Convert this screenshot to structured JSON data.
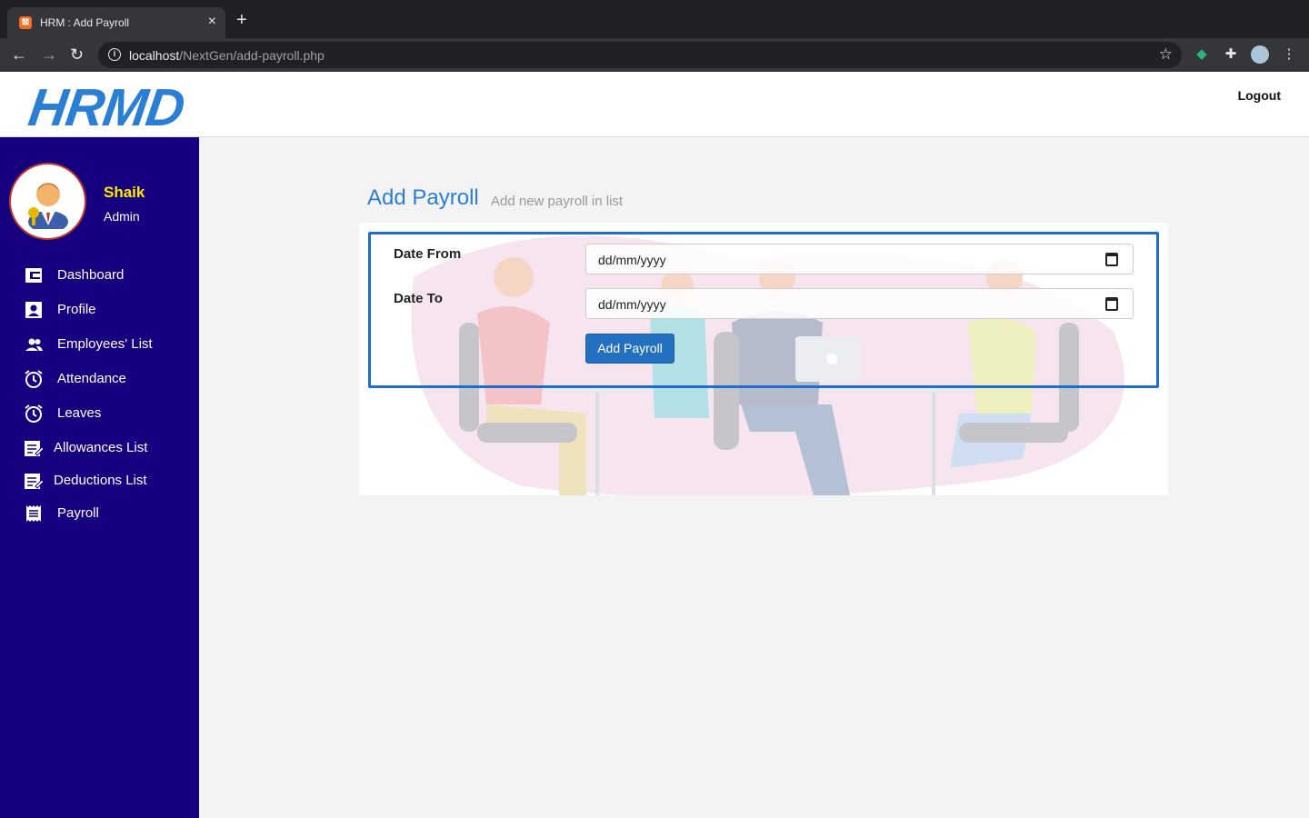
{
  "browser": {
    "tab_title": "HRM : Add Payroll",
    "tab_close": "×",
    "new_tab": "+",
    "url_host": "localhost",
    "url_path": "/NextGen/add-payroll.php"
  },
  "header": {
    "logo": "HRMD",
    "logout_label": "Logout"
  },
  "user": {
    "name": "Shaik",
    "role": "Admin"
  },
  "sidebar": {
    "items": [
      {
        "label": "Dashboard",
        "icon": "dashboard-icon"
      },
      {
        "label": "Profile",
        "icon": "profile-icon"
      },
      {
        "label": "Employees' List",
        "icon": "people-icon"
      },
      {
        "label": "Attendance",
        "icon": "alarm-clock-icon"
      },
      {
        "label": "Leaves",
        "icon": "alarm-clock-icon"
      },
      {
        "label": "Allowances List",
        "icon": "edit-list-icon"
      },
      {
        "label": "Deductions List",
        "icon": "edit-list-icon"
      },
      {
        "label": "Payroll",
        "icon": "receipt-icon"
      }
    ]
  },
  "page": {
    "title": "Add Payroll",
    "subtitle": "Add new payroll in list"
  },
  "form": {
    "date_from_label": "Date From",
    "date_from_value": "dd/mm/yyyy",
    "date_to_label": "Date To",
    "date_to_value": "dd/mm/yyyy",
    "submit_label": "Add Payroll"
  },
  "colors": {
    "sidebar_bg": "#16007f",
    "accent": "#2a7fd4",
    "user_name": "#ffeb00",
    "button": "#2470c0"
  }
}
